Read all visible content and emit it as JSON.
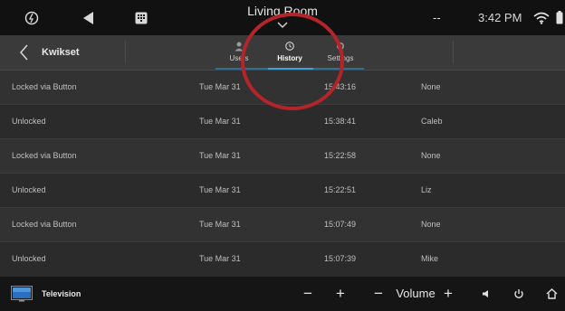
{
  "statusbar": {
    "room": "Living Room",
    "dash": "--",
    "time": "3:42 PM"
  },
  "header": {
    "device": "Kwikset",
    "tabs": [
      {
        "label": "Users"
      },
      {
        "label": "History",
        "active": true
      },
      {
        "label": "Settings"
      }
    ]
  },
  "history": [
    {
      "action": "Locked via Button",
      "date": "Tue Mar 31",
      "time": "15:43:16",
      "user": "None"
    },
    {
      "action": "Unlocked",
      "date": "Tue Mar 31",
      "time": "15:38:41",
      "user": "Caleb"
    },
    {
      "action": "Locked via Button",
      "date": "Tue Mar 31",
      "time": "15:22:58",
      "user": "None"
    },
    {
      "action": "Unlocked",
      "date": "Tue Mar 31",
      "time": "15:22:51",
      "user": "Liz"
    },
    {
      "action": "Locked via Button",
      "date": "Tue Mar 31",
      "time": "15:07:49",
      "user": "None"
    },
    {
      "action": "Unlocked",
      "date": "Tue Mar 31",
      "time": "15:07:39",
      "user": "Mike"
    }
  ],
  "bottombar": {
    "source": "Television",
    "minus": "−",
    "plus": "+",
    "volume_minus": "−",
    "volume_label": "Volume",
    "volume_plus": "+"
  },
  "colors": {
    "accent": "#3aa0d8",
    "highlight": "#b3242b"
  }
}
